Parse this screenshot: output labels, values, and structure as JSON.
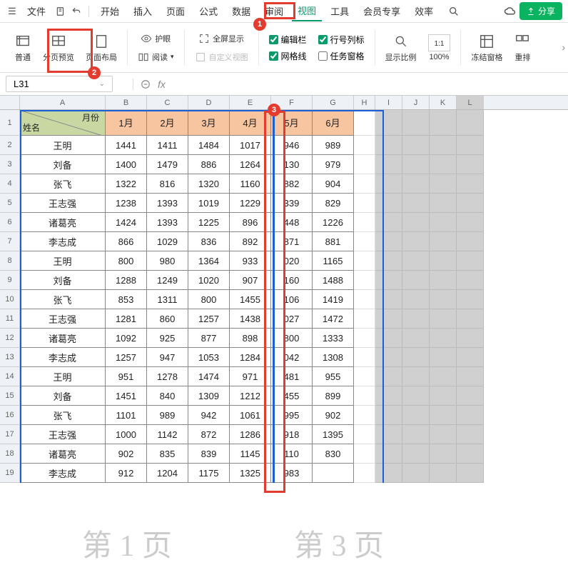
{
  "menubar": {
    "file": "文件",
    "items": [
      "开始",
      "插入",
      "页面",
      "公式",
      "数据",
      "审阅",
      "视图",
      "工具",
      "会员专享",
      "效率"
    ],
    "active_index": 6,
    "share": "分享"
  },
  "ribbon": {
    "normal": "普通",
    "page_break": "分页预览",
    "page_layout": "页面布局",
    "eye_protect": "护眼",
    "read": "阅读",
    "fullscreen": "全屏显示",
    "custom_view": "自定义视图",
    "chk_editbar": "编辑栏",
    "chk_rowcol": "行号列标",
    "chk_gridlines": "网格线",
    "chk_taskpane": "任务窗格",
    "zoom_label": "显示比例",
    "zoom_value": "100%",
    "freeze": "冻结窗格",
    "rearrange": "重排"
  },
  "namebox": "L31",
  "columns": [
    "A",
    "B",
    "C",
    "D",
    "E",
    "F",
    "G",
    "H",
    "I",
    "J",
    "K",
    "L"
  ],
  "header": {
    "diag1": "月份",
    "diag2": "姓名",
    "months": [
      "1月",
      "2月",
      "3月",
      "4月",
      "5月",
      "6月"
    ]
  },
  "rows": [
    {
      "name": "王明",
      "v": [
        1441,
        1411,
        1484,
        1017,
        946,
        989
      ]
    },
    {
      "name": "刘备",
      "v": [
        1400,
        1479,
        886,
        1264,
        130,
        979
      ]
    },
    {
      "name": "张飞",
      "v": [
        1322,
        816,
        1320,
        1160,
        882,
        904
      ]
    },
    {
      "name": "王志强",
      "v": [
        1238,
        1393,
        1019,
        1229,
        339,
        829
      ]
    },
    {
      "name": "诸葛亮",
      "v": [
        1424,
        1393,
        1225,
        896,
        448,
        1226
      ]
    },
    {
      "name": "李志成",
      "v": [
        866,
        1029,
        836,
        892,
        871,
        881
      ]
    },
    {
      "name": "王明",
      "v": [
        800,
        980,
        1364,
        933,
        "020",
        1165
      ]
    },
    {
      "name": "刘备",
      "v": [
        1288,
        1249,
        1020,
        907,
        160,
        1488
      ]
    },
    {
      "name": "张飞",
      "v": [
        853,
        1311,
        800,
        1455,
        106,
        1419
      ]
    },
    {
      "name": "王志强",
      "v": [
        1281,
        860,
        1257,
        1438,
        "027",
        1472
      ]
    },
    {
      "name": "诸葛亮",
      "v": [
        1092,
        925,
        877,
        898,
        800,
        1333
      ]
    },
    {
      "name": "李志成",
      "v": [
        1257,
        947,
        1053,
        1284,
        "042",
        1308
      ]
    },
    {
      "name": "王明",
      "v": [
        951,
        1278,
        1474,
        971,
        481,
        955
      ]
    },
    {
      "name": "刘备",
      "v": [
        1451,
        840,
        1309,
        1212,
        455,
        899
      ]
    },
    {
      "name": "张飞",
      "v": [
        1101,
        989,
        942,
        1061,
        995,
        902
      ]
    },
    {
      "name": "王志强",
      "v": [
        1000,
        1142,
        872,
        1286,
        918,
        1395
      ]
    },
    {
      "name": "诸葛亮",
      "v": [
        902,
        835,
        839,
        1145,
        110,
        830
      ]
    },
    {
      "name": "李志成",
      "v": [
        912,
        1204,
        1175,
        1325,
        983,
        ""
      ]
    }
  ],
  "watermarks": {
    "w1": "第 1 页",
    "w2": "第 3 页"
  },
  "annotations": {
    "b1": "1",
    "b2": "2",
    "b3": "3"
  },
  "chart_data": {
    "type": "table",
    "title": "",
    "columns": [
      "姓名",
      "1月",
      "2月",
      "3月",
      "4月",
      "5月",
      "6月"
    ],
    "rows": [
      [
        "王明",
        1441,
        1411,
        1484,
        1017,
        946,
        989
      ],
      [
        "刘备",
        1400,
        1479,
        886,
        1264,
        130,
        979
      ],
      [
        "张飞",
        1322,
        816,
        1320,
        1160,
        882,
        904
      ],
      [
        "王志强",
        1238,
        1393,
        1019,
        1229,
        339,
        829
      ],
      [
        "诸葛亮",
        1424,
        1393,
        1225,
        896,
        448,
        1226
      ],
      [
        "李志成",
        866,
        1029,
        836,
        892,
        871,
        881
      ],
      [
        "王明",
        800,
        980,
        1364,
        933,
        20,
        1165
      ],
      [
        "刘备",
        1288,
        1249,
        1020,
        907,
        160,
        1488
      ],
      [
        "张飞",
        853,
        1311,
        800,
        1455,
        106,
        1419
      ],
      [
        "王志强",
        1281,
        860,
        1257,
        1438,
        27,
        1472
      ],
      [
        "诸葛亮",
        1092,
        925,
        877,
        898,
        800,
        1333
      ],
      [
        "李志成",
        1257,
        947,
        1053,
        1284,
        42,
        1308
      ],
      [
        "王明",
        951,
        1278,
        1474,
        971,
        481,
        955
      ],
      [
        "刘备",
        1451,
        840,
        1309,
        1212,
        455,
        899
      ],
      [
        "张飞",
        1101,
        989,
        942,
        1061,
        995,
        902
      ],
      [
        "王志强",
        1000,
        1142,
        872,
        1286,
        918,
        1395
      ],
      [
        "诸葛亮",
        902,
        835,
        839,
        1145,
        110,
        830
      ],
      [
        "李志成",
        912,
        1204,
        1175,
        1325,
        983,
        null
      ]
    ]
  }
}
